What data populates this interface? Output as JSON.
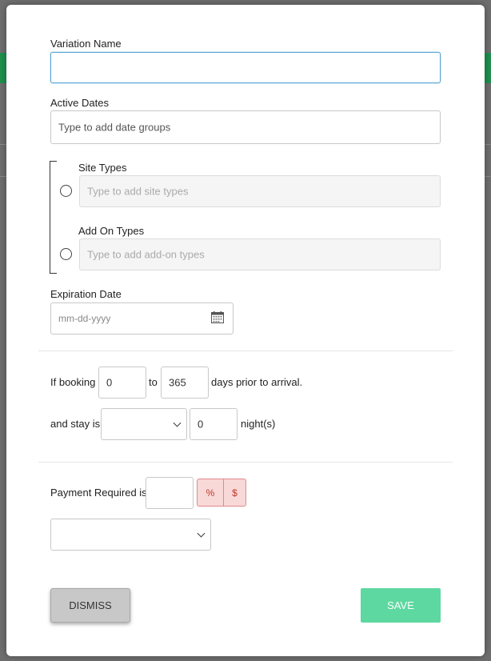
{
  "form": {
    "variation_name_label": "Variation Name",
    "variation_name_value": "",
    "active_dates_label": "Active Dates",
    "active_dates_placeholder": "Type to add date groups",
    "site_types_label": "Site Types",
    "site_types_placeholder": "Type to add site types",
    "add_on_types_label": "Add On Types",
    "add_on_types_placeholder": "Type to add add-on types",
    "expiration_date_label": "Expiration Date",
    "expiration_date_placeholder": "mm-dd-yyyy"
  },
  "booking": {
    "prefix": "If booking",
    "from_value": "0",
    "to_word": "to",
    "to_value": "365",
    "suffix": "days prior to arrival."
  },
  "stay": {
    "prefix": "and stay is",
    "operator_selected": "",
    "nights_value": "0",
    "suffix": "night(s)"
  },
  "payment": {
    "label": "Payment Required is",
    "amount_value": "",
    "percent_symbol": "%",
    "dollar_symbol": "$",
    "type_selected": ""
  },
  "buttons": {
    "dismiss": "DISMISS",
    "save": "SAVE"
  },
  "colors": {
    "save_button": "#5dd8a0",
    "toggle_bg": "#f9d8d8",
    "toggle_text": "#c0392b",
    "focus_border": "#5aa7d6"
  }
}
